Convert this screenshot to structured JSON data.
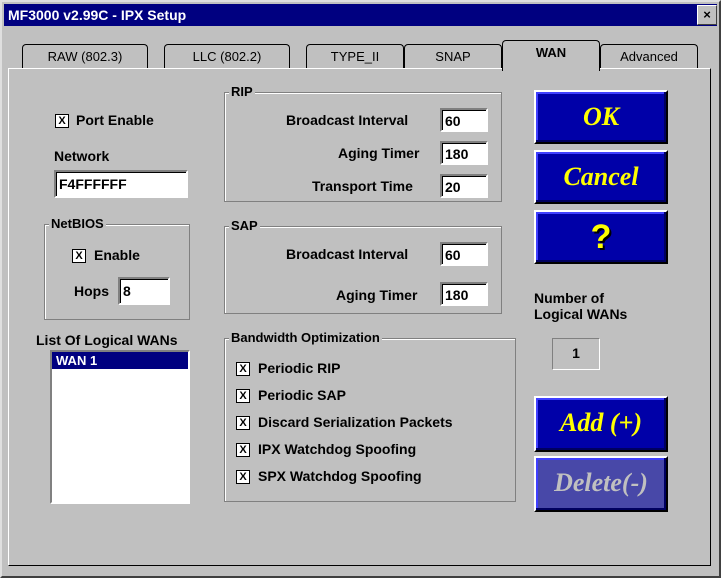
{
  "window": {
    "title": "MF3000 v2.99C - IPX Setup",
    "close_glyph": "×"
  },
  "tabs": [
    "RAW (802.3)",
    "LLC (802.2)",
    "TYPE_II",
    "SNAP",
    "WAN",
    "Advanced"
  ],
  "active_tab": "WAN",
  "port": {
    "label": "Port Enable",
    "checked": "X",
    "network_label": "Network",
    "network_value": "F4FFFFFF"
  },
  "netbios": {
    "title": "NetBIOS",
    "enable_label": "Enable",
    "enable_checked": "X",
    "hops_label": "Hops",
    "hops_value": "8"
  },
  "rip": {
    "title": "RIP",
    "broadcast_label": "Broadcast Interval",
    "broadcast_value": "60",
    "aging_label": "Aging Timer",
    "aging_value": "180",
    "transport_label": "Transport Time",
    "transport_value": "20"
  },
  "sap": {
    "title": "SAP",
    "broadcast_label": "Broadcast Interval",
    "broadcast_value": "60",
    "aging_label": "Aging Timer",
    "aging_value": "180"
  },
  "wans": {
    "list_label": "List Of Logical WANs",
    "items": [
      "WAN 1"
    ],
    "count_label_1": "Number of",
    "count_label_2": "Logical WANs",
    "count_value": "1"
  },
  "bandwidth": {
    "title": "Bandwidth Optimization",
    "items": [
      {
        "label": "Periodic RIP",
        "checked": "X"
      },
      {
        "label": "Periodic SAP",
        "checked": "X"
      },
      {
        "label": "Discard Serialization Packets",
        "checked": "X"
      },
      {
        "label": "IPX Watchdog Spoofing",
        "checked": "X"
      },
      {
        "label": "SPX Watchdog Spoofing",
        "checked": "X"
      }
    ]
  },
  "buttons": {
    "ok": "OK",
    "cancel": "Cancel",
    "help": "?",
    "add": "Add (+)",
    "delete": "Delete(-)"
  },
  "colors": {
    "titlebar": "#000080",
    "button_face": "#0000a8",
    "button_text": "#ffff00",
    "dialog": "#c0c0c0"
  }
}
